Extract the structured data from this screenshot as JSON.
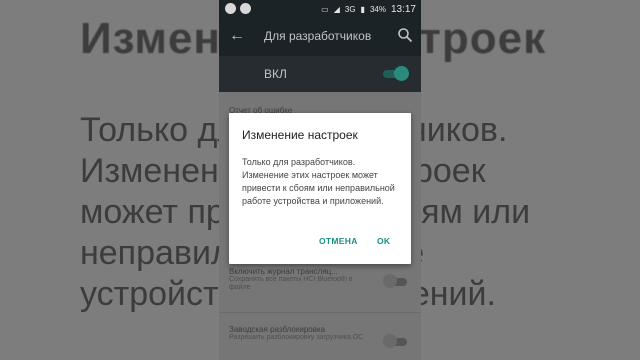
{
  "background": {
    "title": "Изменение настроек",
    "body": "Только для разработчиков.\nИзменение этих настроек\nможет привести к сбоям или\nнеправильной работе\nустройства и приложений."
  },
  "status_bar": {
    "battery": "34%",
    "time": "13:17",
    "network": "3G"
  },
  "toolbar": {
    "back_icon": "arrow-back-icon",
    "title": "Для разработчиков",
    "search_icon": "search-icon"
  },
  "master_switch": {
    "label": "ВКЛ",
    "state": "on"
  },
  "settings": [
    {
      "title": "Отчет об ошибке",
      "subtitle": ""
    },
    {
      "title": "Включить журнал трансляц...",
      "subtitle": "Сохранять все пакеты HCI Bluetooth в файле"
    },
    {
      "title": "Заводская разблокировка",
      "subtitle": "Разрешить разблокировку загрузчика ОС"
    }
  ],
  "dialog": {
    "title": "Изменение настроек",
    "body": "Только для разработчиков. Изменение этих настроек может привести к сбоям или неправильной работе устройства и приложений.",
    "cancel_label": "ОТМЕНА",
    "ok_label": "OK"
  },
  "colors": {
    "accent": "#1b8f80",
    "toolbar": "#1c2327"
  }
}
